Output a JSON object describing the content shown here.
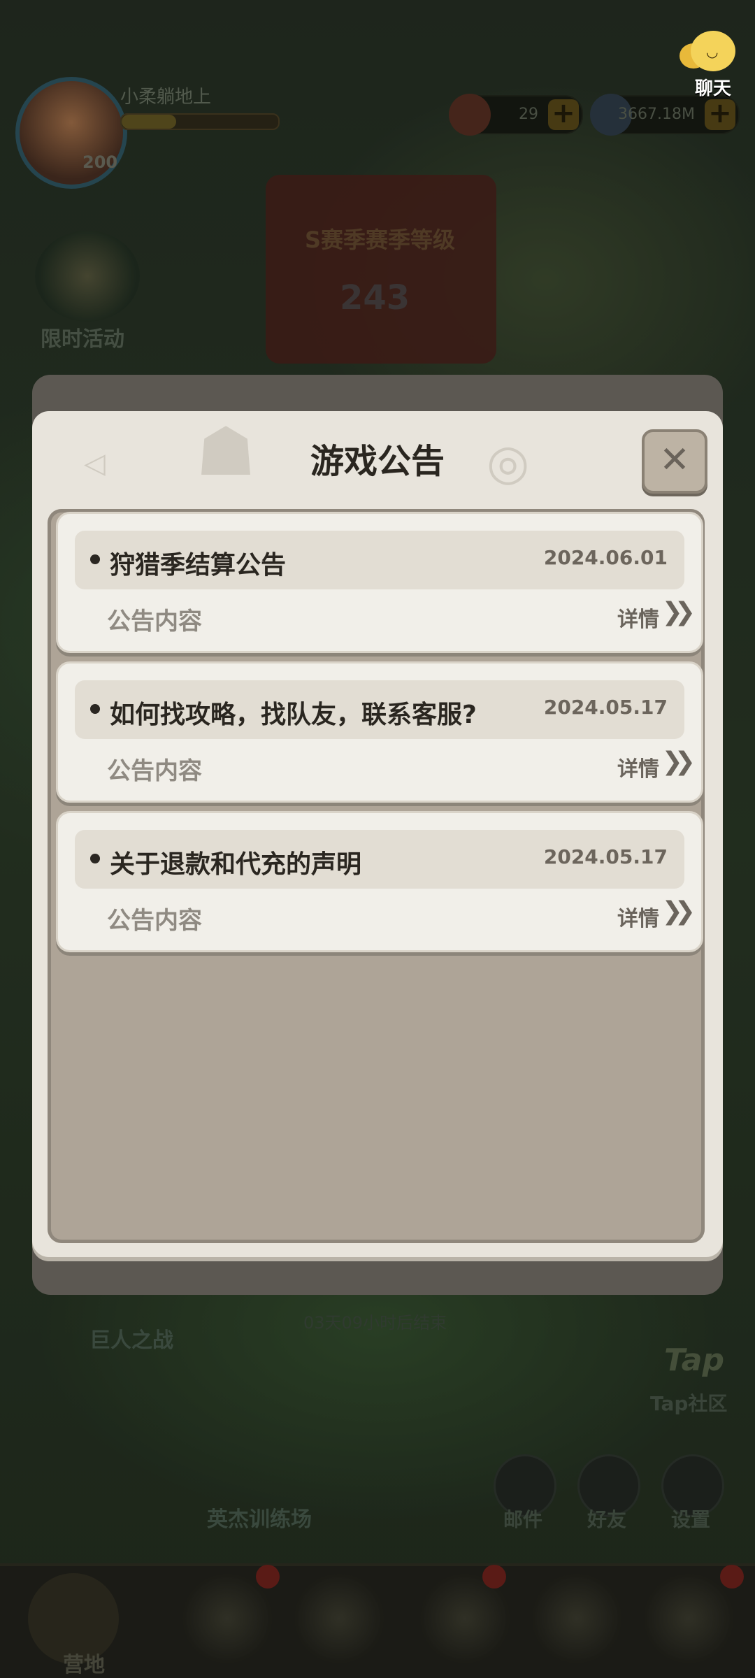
{
  "chat": {
    "label": "聊天"
  },
  "player": {
    "name": "小柔躺地上",
    "level": "200"
  },
  "resources": [
    {
      "icon": "meat-icon",
      "value": "29"
    },
    {
      "icon": "stone-icon",
      "value": "3667.18M"
    }
  ],
  "background": {
    "event_label": "限时活动",
    "season_title": "S赛季赛季等级",
    "season_level": "243",
    "giant_label": "巨人之战",
    "timer_label": "03天09小时后结束",
    "tap_logo": "Tap",
    "tap_label": "Tap社区",
    "train_label": "英杰训练场",
    "buttons": [
      {
        "label": "邮件",
        "icon": "mail-icon"
      },
      {
        "label": "好友",
        "icon": "friends-icon"
      },
      {
        "label": "设置",
        "icon": "settings-icon"
      }
    ],
    "nav_active_label": "营地"
  },
  "modal": {
    "title": "游戏公告",
    "close_symbol": "✕",
    "notices": [
      {
        "title": "狩猎季结算公告",
        "date": "2024.06.01",
        "body": "公告内容",
        "detail": "详情",
        "chevron": "❯❯"
      },
      {
        "title": "如何找攻略，找队友，联系客服?",
        "date": "2024.05.17",
        "body": "公告内容",
        "detail": "详情",
        "chevron": "❯❯"
      },
      {
        "title": "关于退款和代充的声明",
        "date": "2024.05.17",
        "body": "公告内容",
        "detail": "详情",
        "chevron": "❯❯"
      }
    ]
  }
}
